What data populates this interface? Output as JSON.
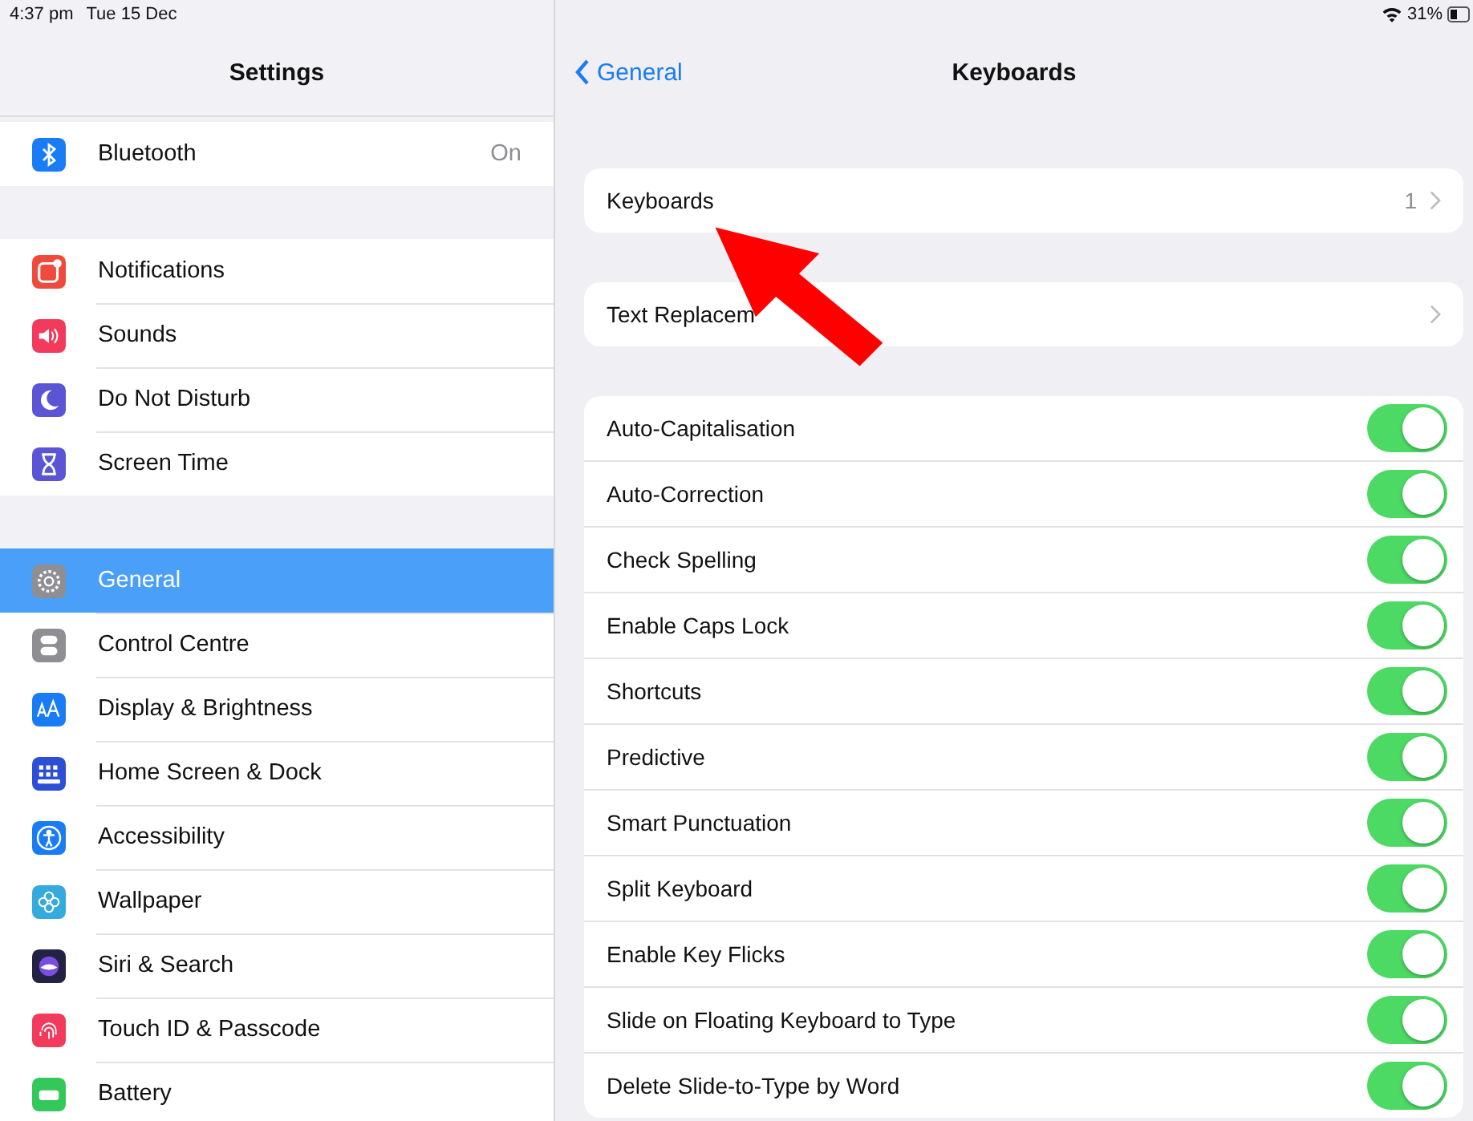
{
  "status_bar": {
    "time": "4:37 pm",
    "date": "Tue 15 Dec",
    "battery": "31%"
  },
  "sidebar": {
    "title": "Settings",
    "groups": [
      [
        {
          "label": "Bluetooth",
          "value": "On",
          "color": "#1a7cf5",
          "selected": false
        }
      ],
      [
        {
          "label": "Notifications",
          "color": "#f04a3c",
          "selected": false
        },
        {
          "label": "Sounds",
          "color": "#f23a5c",
          "selected": false
        },
        {
          "label": "Do Not Disturb",
          "color": "#5b55d6",
          "selected": false
        },
        {
          "label": "Screen Time",
          "color": "#5b55d6",
          "selected": false
        }
      ],
      [
        {
          "label": "General",
          "color": "#8e8e93",
          "selected": true
        },
        {
          "label": "Control Centre",
          "color": "#8e8e93",
          "selected": false
        },
        {
          "label": "Display & Brightness",
          "color": "#1a7cf5",
          "selected": false
        },
        {
          "label": "Home Screen & Dock",
          "color": "#2c4fd6",
          "selected": false
        },
        {
          "label": "Accessibility",
          "color": "#1a7cf5",
          "selected": false
        },
        {
          "label": "Wallpaper",
          "color": "#35aadc",
          "selected": false
        },
        {
          "label": "Siri & Search",
          "color": "#222244",
          "selected": false
        },
        {
          "label": "Touch ID & Passcode",
          "color": "#f23a5c",
          "selected": false
        },
        {
          "label": "Battery",
          "color": "#34c759",
          "selected": false
        }
      ]
    ]
  },
  "detail": {
    "back": "General",
    "title": "Keyboards",
    "links": [
      {
        "label": "Keyboards",
        "value": "1"
      },
      {
        "label": "Text Replacem"
      }
    ],
    "toggles": [
      {
        "label": "Auto-Capitalisation",
        "on": true
      },
      {
        "label": "Auto-Correction",
        "on": true
      },
      {
        "label": "Check Spelling",
        "on": true
      },
      {
        "label": "Enable Caps Lock",
        "on": true
      },
      {
        "label": "Shortcuts",
        "on": true
      },
      {
        "label": "Predictive",
        "on": true
      },
      {
        "label": "Smart Punctuation",
        "on": true
      },
      {
        "label": "Split Keyboard",
        "on": true
      },
      {
        "label": "Enable Key Flicks",
        "on": true
      },
      {
        "label": "Slide on Floating Keyboard to Type",
        "on": true
      },
      {
        "label": "Delete Slide-to-Type by Word",
        "on": true
      }
    ]
  }
}
